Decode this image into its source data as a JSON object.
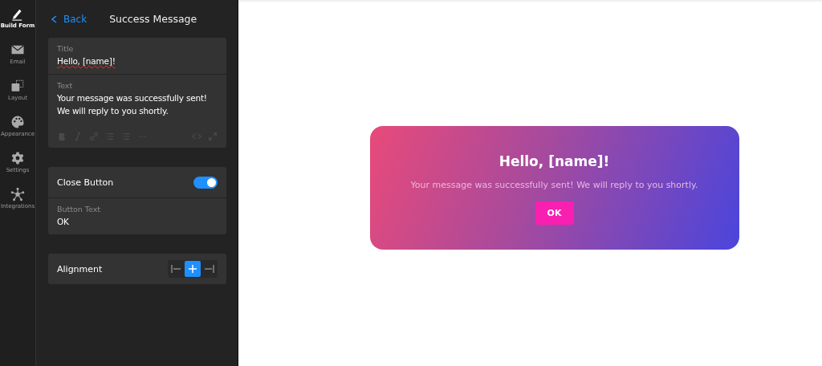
{
  "nav": [
    {
      "label": "Build Form",
      "selected": true
    },
    {
      "label": "Email",
      "selected": false
    },
    {
      "label": "Layout",
      "selected": false
    },
    {
      "label": "Appearance",
      "selected": false
    },
    {
      "label": "Settings",
      "selected": false
    },
    {
      "label": "Integrations",
      "selected": false
    }
  ],
  "header": {
    "back": "Back",
    "title": "Success Message"
  },
  "title_field": {
    "label": "Title",
    "value": "Hello, [name]!"
  },
  "text_field": {
    "label": "Text",
    "value": "Your message was successfully sent! We will reply to you shortly."
  },
  "close_button": {
    "label": "Close Button",
    "on": true
  },
  "button_text": {
    "label": "Button Text",
    "value": "OK"
  },
  "alignment": {
    "label": "Alignment",
    "options": [
      {
        "kind": "left",
        "selected": false
      },
      {
        "kind": "center",
        "selected": true
      },
      {
        "kind": "right",
        "selected": false
      }
    ]
  },
  "preview": {
    "title": "Hello, [name]!",
    "text": "Your message was successfully sent! We will reply to you shortly.",
    "button": "OK"
  }
}
